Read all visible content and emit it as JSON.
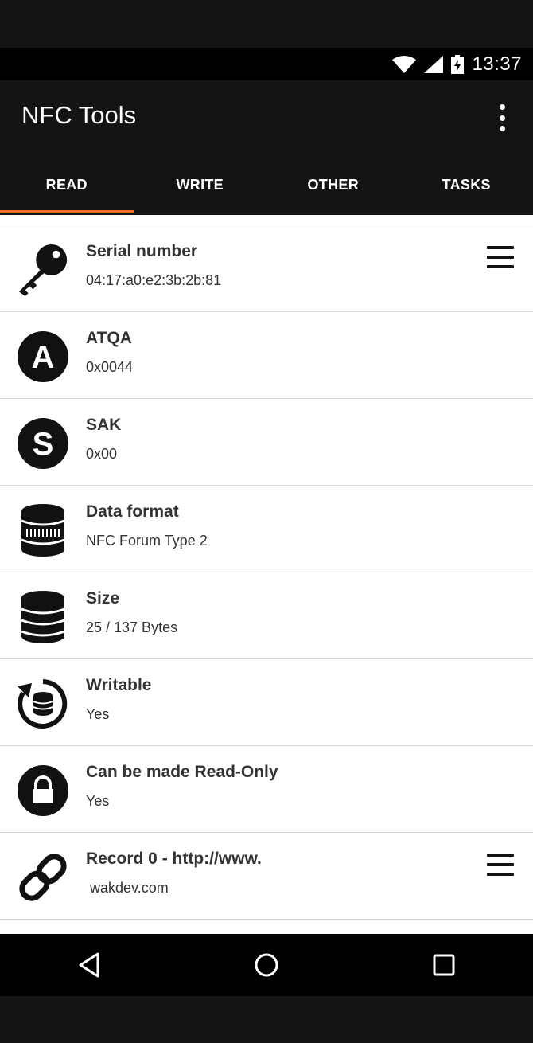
{
  "status_bar": {
    "time": "13:37"
  },
  "app": {
    "title": "NFC Tools"
  },
  "tabs": [
    {
      "label": "READ",
      "active": true
    },
    {
      "label": "WRITE",
      "active": false
    },
    {
      "label": "OTHER",
      "active": false
    },
    {
      "label": "TASKS",
      "active": false
    }
  ],
  "rows": [
    {
      "title": "Serial number",
      "value": "04:17:a0:e2:3b:2b:81",
      "icon": "key-icon",
      "has_menu": true
    },
    {
      "title": "ATQA",
      "value": "0x0044",
      "icon": "letter-a-icon",
      "has_menu": false
    },
    {
      "title": "SAK",
      "value": "0x00",
      "icon": "letter-s-icon",
      "has_menu": false
    },
    {
      "title": "Data format",
      "value": "NFC Forum Type 2",
      "icon": "database-format-icon",
      "has_menu": false
    },
    {
      "title": "Size",
      "value": "25 / 137 Bytes",
      "icon": "database-icon",
      "has_menu": false
    },
    {
      "title": "Writable",
      "value": "Yes",
      "icon": "rewrite-database-icon",
      "has_menu": false
    },
    {
      "title": "Can be made Read-Only",
      "value": "Yes",
      "icon": "lock-icon",
      "has_menu": false
    },
    {
      "title": "Record 0 - http://www.",
      "value": " wakdev.com",
      "icon": "link-icon",
      "has_menu": true
    }
  ],
  "colors": {
    "accent": "#f26b21",
    "toolbar": "#141414",
    "status_bar": "#000000"
  },
  "navbar": [
    "back-icon",
    "home-icon",
    "recents-icon"
  ]
}
